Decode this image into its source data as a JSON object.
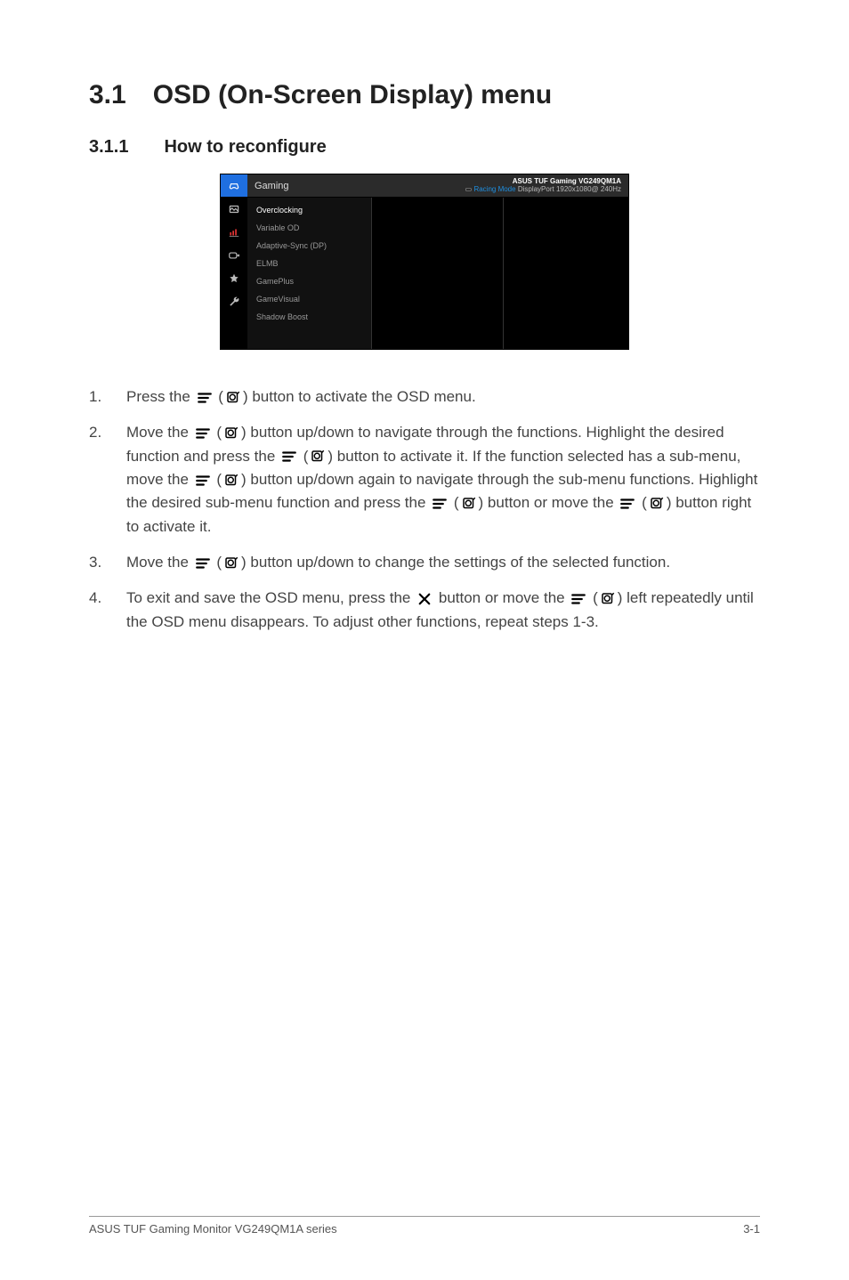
{
  "heading": {
    "num": "3.1",
    "title": "OSD (On-Screen Display) menu"
  },
  "subheading": {
    "num": "3.1.1",
    "title": "How to reconfigure"
  },
  "osd": {
    "header_title": "Gaming",
    "header_top": "ASUS TUF Gaming  VG249QM1A",
    "header_mode_label": "Racing Mode",
    "header_signal": "DisplayPort  1920x1080@ 240Hz",
    "items": [
      "Overclocking",
      "Variable OD",
      "Adaptive-Sync (DP)",
      "ELMB",
      "GamePlus",
      "GameVisual",
      "Shadow Boost"
    ],
    "side_icons": [
      "controller-icon",
      "picture-icon",
      "bars-icon",
      "input-icon",
      "star-icon",
      "wrench-icon"
    ]
  },
  "steps": {
    "s1a": "Press the ",
    "s1b": ") button to activate the OSD menu.",
    "s2a": "Move the ",
    "s2b": ") button up/down to navigate through the functions. Highlight the desired function and press the ",
    "s2c": ") button to activate it. If the function selected has a sub-menu, move the ",
    "s2d": ") button up/down again to navigate through the sub-menu functions. Highlight the desired sub-menu function and press the ",
    "s2e": ") button or move the ",
    "s2f": ") button right to activate it.",
    "s3a": "Move the ",
    "s3b": ") button up/down to change the settings of the selected function.",
    "s4a": "To exit and save the OSD menu, press the ",
    "s4b": " button or move the ",
    "s4c": ") left repeatedly until the OSD menu disappears. To adjust other functions, repeat steps 1-3."
  },
  "footer": {
    "left": "ASUS TUF Gaming Monitor VG249QM1A series",
    "right": "3-1"
  }
}
